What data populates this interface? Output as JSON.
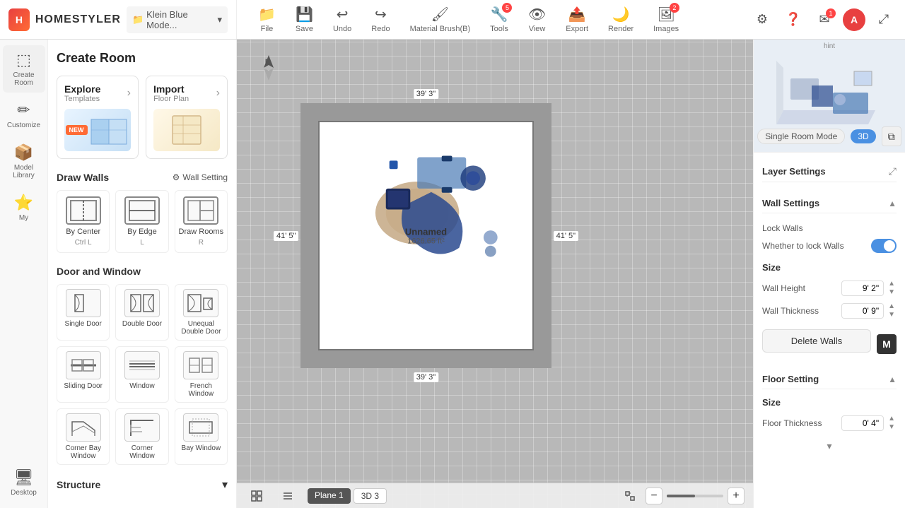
{
  "app": {
    "name": "HOMESTYLER",
    "project": "Klein Blue Mode..."
  },
  "toolbar": {
    "items": [
      {
        "id": "file",
        "label": "File",
        "icon": "📁",
        "badge": null
      },
      {
        "id": "save",
        "label": "Save",
        "icon": "💾",
        "badge": null
      },
      {
        "id": "undo",
        "label": "Undo",
        "icon": "↩",
        "badge": null
      },
      {
        "id": "redo",
        "label": "Redo",
        "icon": "↪",
        "badge": null
      },
      {
        "id": "material-brush",
        "label": "Material Brush(B)",
        "icon": "🖌",
        "badge": null
      },
      {
        "id": "tools",
        "label": "Tools",
        "icon": "🔧",
        "badge": "5"
      },
      {
        "id": "view",
        "label": "View",
        "icon": "👁",
        "badge": null
      },
      {
        "id": "export",
        "label": "Export",
        "icon": "📤",
        "badge": null
      },
      {
        "id": "render",
        "label": "Render",
        "icon": "🌙",
        "badge": null
      },
      {
        "id": "images",
        "label": "Images",
        "icon": "🖼",
        "badge": "2"
      }
    ]
  },
  "sidebar": {
    "items": [
      {
        "id": "create-room",
        "label": "Create Room",
        "icon": "⬚"
      },
      {
        "id": "customize",
        "label": "Customize",
        "icon": "✏"
      },
      {
        "id": "model-library",
        "label": "Model Library",
        "icon": "📦"
      },
      {
        "id": "my",
        "label": "My",
        "icon": "👤"
      },
      {
        "id": "desktop",
        "label": "Desktop",
        "icon": "🖥"
      }
    ]
  },
  "panel": {
    "title": "Create Room",
    "explore": {
      "title": "Explore",
      "subtitle": "Templates",
      "arrow": "›",
      "has_new": true
    },
    "import": {
      "title": "Import",
      "subtitle": "Floor Plan",
      "arrow": "›"
    },
    "draw_walls": {
      "title": "Draw Walls",
      "wall_setting_label": "Wall Setting",
      "items": [
        {
          "id": "by-center",
          "label": "By Center",
          "shortcut": "Ctrl L"
        },
        {
          "id": "by-edge",
          "label": "By Edge",
          "shortcut": "L"
        },
        {
          "id": "draw-rooms",
          "label": "Draw Rooms",
          "shortcut": "R"
        }
      ]
    },
    "door_window": {
      "title": "Door and Window",
      "items": [
        {
          "id": "single-door",
          "label": "Single Door"
        },
        {
          "id": "double-door",
          "label": "Double Door"
        },
        {
          "id": "unequal-double-door",
          "label": "Unequal Double Door"
        },
        {
          "id": "sliding-door",
          "label": "Sliding Door"
        },
        {
          "id": "window",
          "label": "Window"
        },
        {
          "id": "french-window",
          "label": "French Window"
        },
        {
          "id": "corner-bay-window",
          "label": "Corner Bay Window"
        },
        {
          "id": "corner-window",
          "label": "Corner Window"
        },
        {
          "id": "bay-window",
          "label": "Bay Window"
        }
      ]
    },
    "structure": {
      "title": "Structure"
    }
  },
  "canvas": {
    "north_arrow": "⬆",
    "room_name": "Unnamed",
    "room_area": "1626.65 ft²",
    "dim_top": "39' 3\"",
    "dim_bottom": "39' 3\"",
    "dim_left": "41' 5\"",
    "dim_right": "41' 5\"",
    "plane_tabs": [
      {
        "id": "plane1",
        "label": "Plane 1",
        "active": true
      },
      {
        "id": "3d3",
        "label": "3D 3",
        "active": false
      }
    ]
  },
  "right_panel": {
    "preview_label": "hint",
    "mode_single": "Single Room Mode",
    "mode_3d": "3D",
    "layer_settings": {
      "title": "Layer Settings"
    },
    "wall_settings": {
      "title": "Wall Settings",
      "lock_walls_label": "Lock Walls",
      "whether_lock_label": "Whether to lock Walls",
      "size_label": "Size",
      "wall_height_label": "Wall Height",
      "wall_height_value": "9' 2\"",
      "wall_thickness_label": "Wall Thickness",
      "wall_thickness_value": "0' 9\"",
      "delete_walls_label": "Delete Walls"
    },
    "floor_setting": {
      "title": "Floor Setting",
      "size_label": "Size",
      "floor_thickness_label": "Floor Thickness",
      "floor_thickness_value": "0' 4\""
    }
  }
}
